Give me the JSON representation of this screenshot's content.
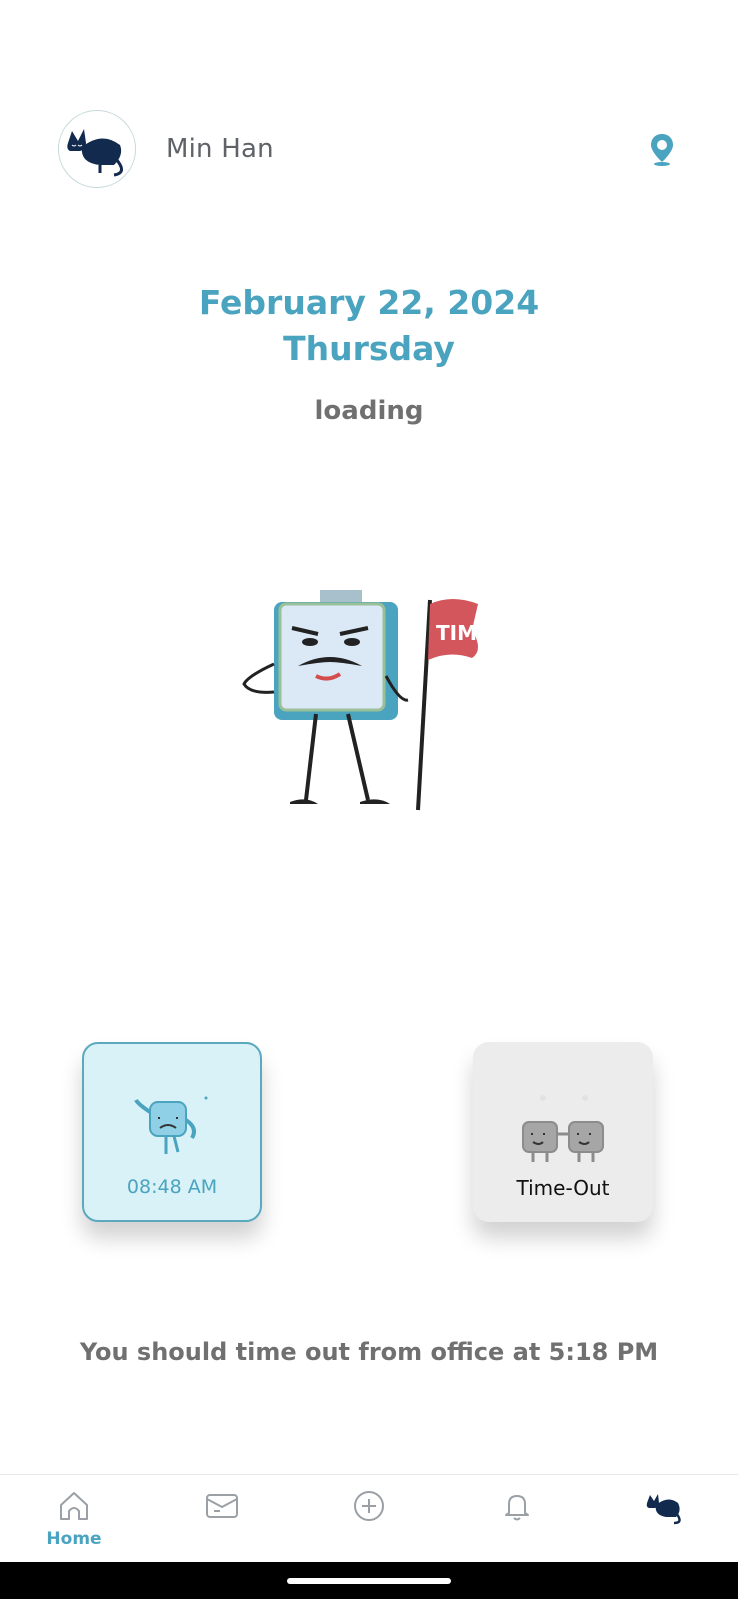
{
  "user": {
    "name": "Min Han",
    "avatar_icon": "sleeping-cat-icon"
  },
  "header": {
    "location_icon": "location-pin-icon"
  },
  "date": {
    "full": "February 22, 2024",
    "weekday": "Thursday",
    "status": "loading"
  },
  "actions": {
    "time_in": {
      "label": "08:48 AM",
      "icon": "waving-block-icon"
    },
    "time_out": {
      "label": "Time-Out",
      "icon": "two-blocks-holding-hands-icon"
    }
  },
  "notice": {
    "text": "You should time out from office at 5:18 PM"
  },
  "mascot": {
    "flag_text": "TIME",
    "icon": "clock-mascot-with-flag"
  },
  "bottom_nav": {
    "items": [
      {
        "label": "Home",
        "icon": "home-icon",
        "active": true
      },
      {
        "label": "",
        "icon": "mail-icon",
        "active": false
      },
      {
        "label": "",
        "icon": "add-circle-icon",
        "active": false
      },
      {
        "label": "",
        "icon": "bell-icon",
        "active": false
      },
      {
        "label": "",
        "icon": "profile-cat-icon",
        "active": false
      }
    ]
  },
  "colors": {
    "accent": "#4aa3bf",
    "text_muted": "#707070",
    "card_in_bg": "#d9f2f7",
    "card_out_bg": "#ececec"
  }
}
